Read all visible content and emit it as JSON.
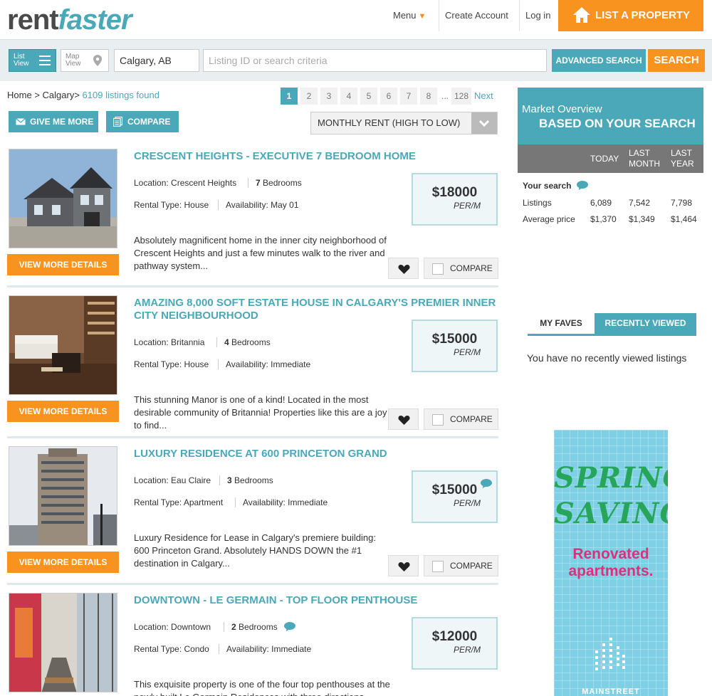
{
  "header": {
    "logo_part1": "rent",
    "logo_part2": "faster",
    "menu_label": "Menu",
    "create_account": "Create Account",
    "login": "Log in",
    "list_property": "LIST A PROPERTY"
  },
  "search": {
    "list_view_line1": "List",
    "list_view_line2": "View",
    "map_view_line1": "Map",
    "map_view_line2": "View",
    "location_value": "Calgary, AB",
    "criteria_placeholder": "Listing ID or search criteria",
    "advanced_label": "ADVANCED SEARCH",
    "search_label": "SEARCH"
  },
  "breadcrumb": {
    "home": "Home",
    "sep": ">",
    "city": "Calgary",
    "found": "6109 listings found"
  },
  "pagination": {
    "pages": [
      "1",
      "2",
      "3",
      "4",
      "5",
      "6",
      "7",
      "8"
    ],
    "dots": "...",
    "last": "128",
    "next": "Next"
  },
  "actions": {
    "give_me_more": "GIVE ME MORE",
    "compare": "COMPARE",
    "sort_value": "MONTHLY RENT (HIGH TO LOW)"
  },
  "listings": [
    {
      "title": "CRESCENT HEIGHTS - EXECUTIVE 7 BEDROOM HOME",
      "location": "Location: Crescent Heights",
      "bedrooms_num": "7",
      "bedrooms_label": "Bedrooms",
      "rental_type": "Rental Type: House",
      "availability": "Availability: May 01",
      "description": "Absolutely magnificent home in the inner city neighborhood of Crescent Heights and just a few minutes walk to the river and pathway system...",
      "price": "$18000",
      "per": "PER/M",
      "details_label": "VIEW MORE DETAILS",
      "compare_label": "COMPARE"
    },
    {
      "title": "AMAZING 8,000 SOFT ESTATE HOUSE IN CALGARY'S PREMIER INNER CITY NEIGHBOURHOOD",
      "location": "Location: Britannia",
      "bedrooms_num": "4",
      "bedrooms_label": "Bedrooms",
      "rental_type": "Rental Type: House",
      "availability": "Availability: Immediate",
      "description": "This stunning Manor is one of a kind!  Located in the most desirable community of Britannia!  Properties like this are a joy to find...",
      "price": "$15000",
      "per": "PER/M",
      "details_label": "VIEW MORE DETAILS",
      "compare_label": "COMPARE"
    },
    {
      "title": "LUXURY RESIDENCE AT 600 PRINCETON GRAND",
      "location": "Location: Eau Claire",
      "bedrooms_num": "3",
      "bedrooms_label": "Bedrooms",
      "rental_type": "Rental Type: Apartment",
      "availability": "Availability: Immediate",
      "description": "Luxury Residence for Lease in Calgary's premiere building: 600 Princeton Grand.  Absolutely HANDS DOWN the #1 destination in Calgary...",
      "price": "$15000",
      "per": "PER/M",
      "details_label": "VIEW MORE DETAILS",
      "compare_label": "COMPARE"
    },
    {
      "title": "DOWNTOWN - LE GERMAIN - TOP FLOOR PENTHOUSE",
      "location": "Location: Downtown",
      "bedrooms_num": "2",
      "bedrooms_label": "Bedrooms",
      "rental_type": "Rental Type: Condo",
      "availability": "Availability: Immediate",
      "description": "This exquisite property is one of the four top penthouses at the newly built Le Germain Residences with three directions",
      "price": "$12000",
      "per": "PER/M"
    }
  ],
  "market": {
    "line1": "Market Overview",
    "line2": "BASED ON YOUR SEARCH",
    "col_today": "TODAY",
    "col_month_1": "LAST",
    "col_month_2": "MONTH",
    "col_year_1": "LAST",
    "col_year_2": "YEAR",
    "your_search": "Your search",
    "listings_label": "Listings",
    "listings_today": "6,089",
    "listings_month": "7,542",
    "listings_year": "7,798",
    "avg_label": "Average price",
    "avg_today": "$1,370",
    "avg_month": "$1,349",
    "avg_year": "$1,464"
  },
  "sidebar_tabs": {
    "faves": "MY FAVES",
    "recent": "RECENTLY VIEWED",
    "empty_text": "You have no recently viewed listings"
  },
  "ad": {
    "line1": "SPRING",
    "line2": "SAVINGS",
    "line3": "Renovated",
    "line4": "apartments.",
    "brand": "MAINSTREET"
  },
  "colors": {
    "teal": "#4aa8b8",
    "orange": "#f7931e"
  }
}
